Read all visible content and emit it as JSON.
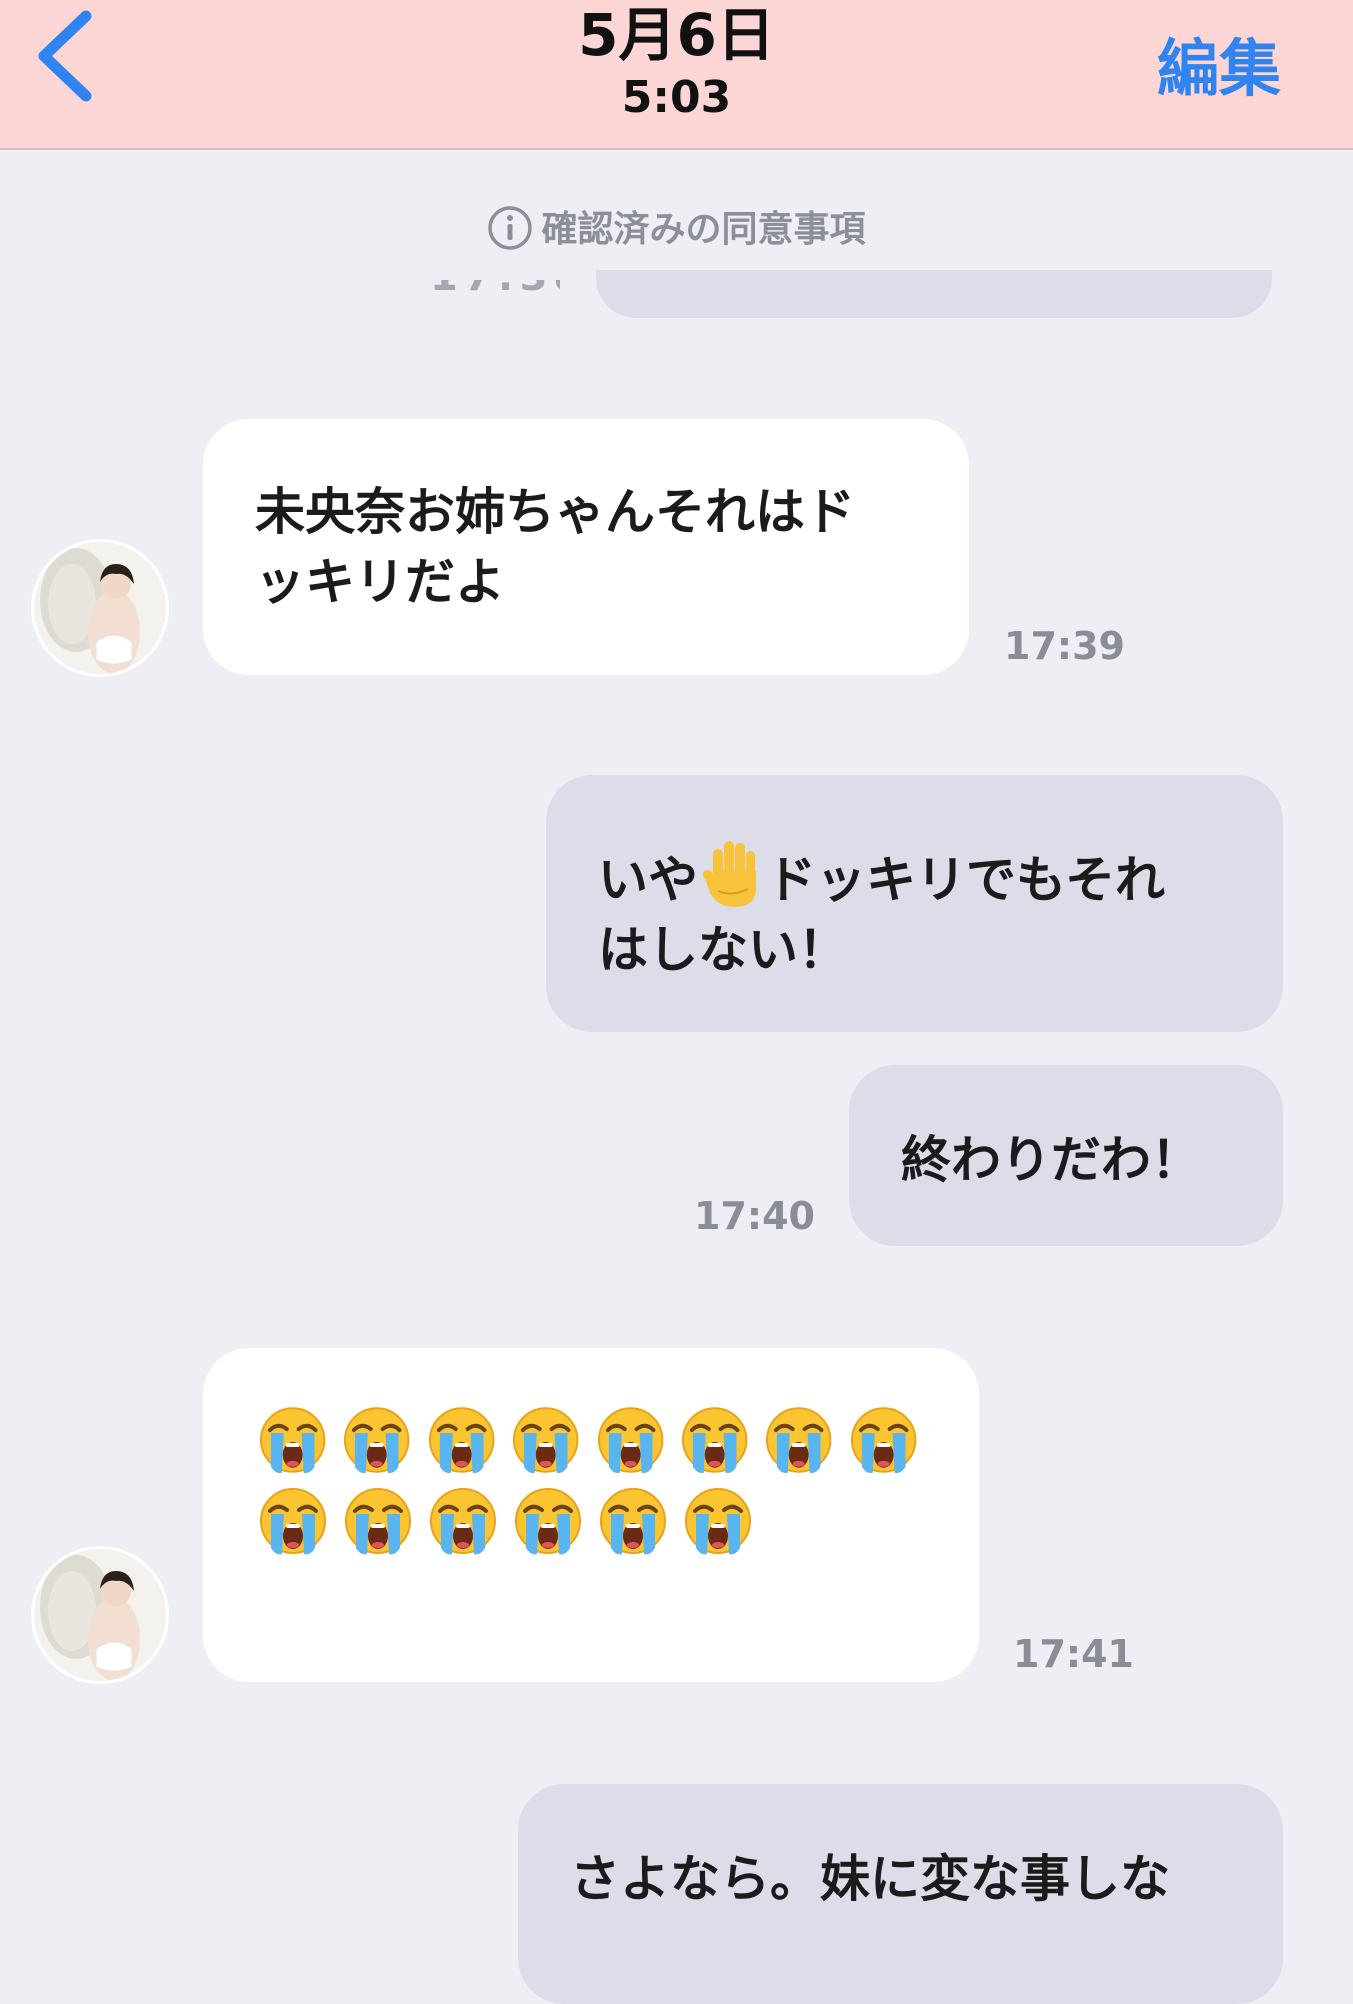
{
  "header": {
    "date": "5月6日",
    "time": "5:03",
    "edit_label": "編集"
  },
  "notice": {
    "text": "確認済みの同意事項"
  },
  "messages": [
    {
      "direction": "incoming",
      "text_line1": "未央奈お姉ちゃんそれはド",
      "text_line2": "ッキリだよ",
      "time": "17:39"
    },
    {
      "direction": "outgoing",
      "text_before_emoji": "いや",
      "emoji": "raised-hand",
      "text_after_emoji": "ドッキリでもそれ",
      "text_line2": "はしない！"
    },
    {
      "direction": "outgoing",
      "text": "終わりだわ！",
      "time": "17:40"
    },
    {
      "direction": "incoming",
      "emoji": "loudly-crying-face",
      "emoji_count": 14,
      "emoji_rows": [
        8,
        6
      ],
      "time": "17:41"
    },
    {
      "direction": "outgoing",
      "text": "さよなら。妹に変な事しな"
    }
  ],
  "colors": {
    "header_background": "#fcd5d5",
    "accent_blue": "#2f84ef",
    "chat_background": "#eeeff5",
    "incoming_bubble": "#ffffff",
    "outgoing_bubble": "#dcdde9"
  }
}
